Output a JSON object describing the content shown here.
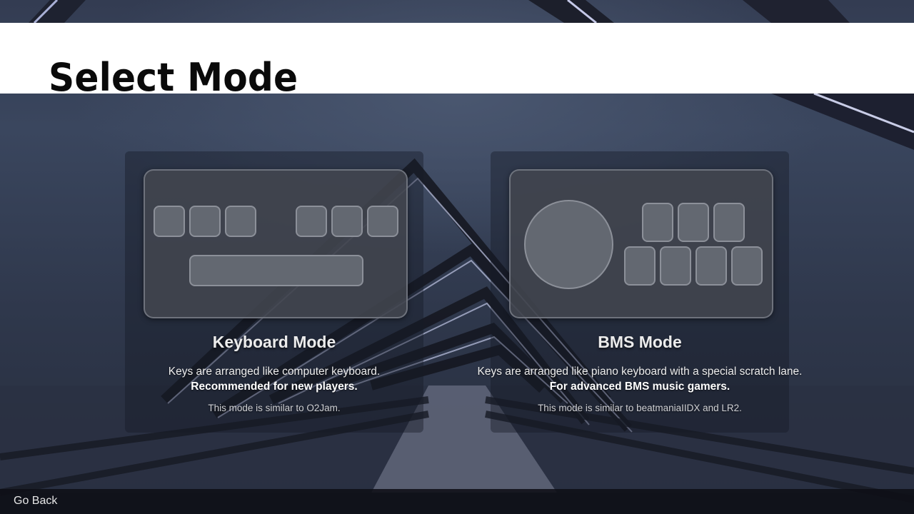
{
  "header": {
    "title": "Select Mode"
  },
  "modes": [
    {
      "id": "keyboard",
      "title": "Keyboard Mode",
      "description": "Keys are arranged like computer keyboard.",
      "highlight": "Recommended for new players.",
      "similar": "This mode is similar to O2Jam.",
      "icon": "keyboard-layout-icon"
    },
    {
      "id": "bms",
      "title": "BMS Mode",
      "description": "Keys are arranged like piano keyboard with a special scratch lane.",
      "highlight": "For advanced BMS music gamers.",
      "similar": "This mode is similar to beatmaniaIIDX and LR2.",
      "icon": "bms-controller-icon"
    }
  ],
  "footer": {
    "back_label": "Go Back"
  }
}
